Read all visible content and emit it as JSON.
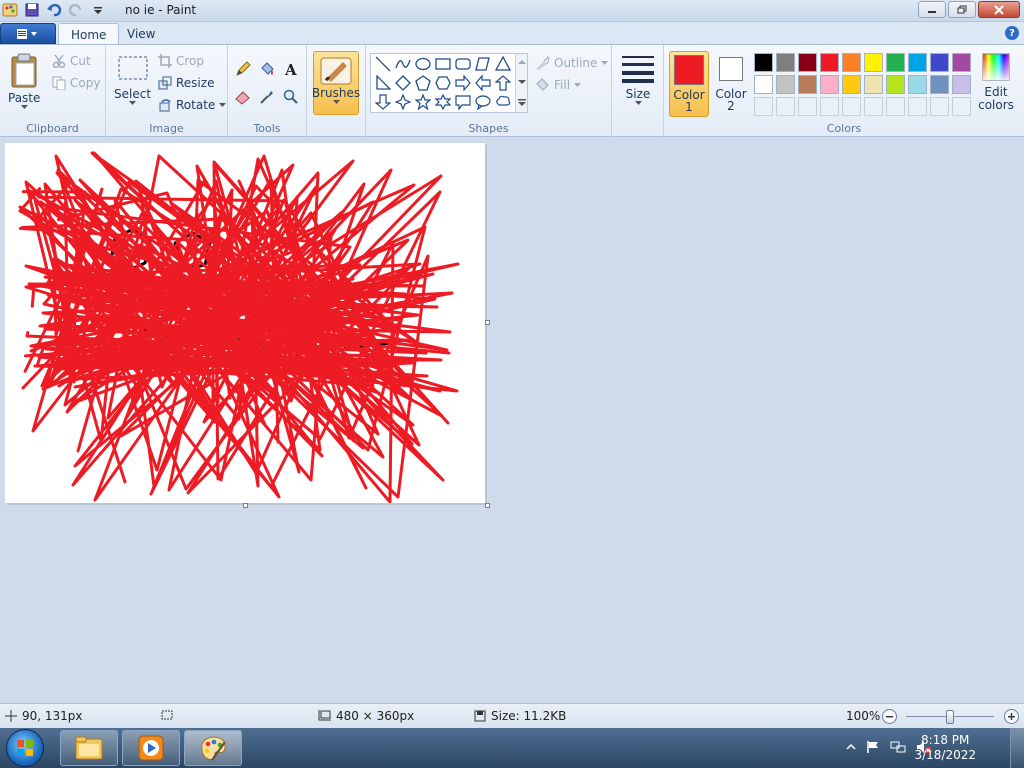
{
  "window": {
    "title": "no ie - Paint"
  },
  "tabs": [
    {
      "label": "Home"
    },
    {
      "label": "View"
    }
  ],
  "clipboard": {
    "paste": "Paste",
    "cut": "Cut",
    "copy": "Copy",
    "group": "Clipboard"
  },
  "image": {
    "select": "Select",
    "crop": "Crop",
    "resize": "Resize",
    "rotate": "Rotate",
    "group": "Image"
  },
  "tools": {
    "group": "Tools"
  },
  "brushes": {
    "label": "Brushes"
  },
  "shapes": {
    "outline": "Outline",
    "fill": "Fill",
    "group": "Shapes"
  },
  "size": {
    "label": "Size"
  },
  "colors": {
    "color1_label": "Color",
    "color1_num": "1",
    "color2_label": "Color",
    "color2_num": "2",
    "edit_label": "Edit",
    "edit_label2": "colors",
    "group": "Colors",
    "color1": "#ed1c24",
    "color2": "#ffffff",
    "row1": [
      "#000000",
      "#7f7f7f",
      "#880015",
      "#ed1c24",
      "#ff7f27",
      "#fff200",
      "#22b14c",
      "#00a2e8",
      "#3f48cc",
      "#a349a4"
    ],
    "row2": [
      "#ffffff",
      "#c3c3c3",
      "#b97a57",
      "#ffaec9",
      "#ffc90e",
      "#efe4b0",
      "#b5e61d",
      "#99d9ea",
      "#7092be",
      "#c8bfe7"
    ]
  },
  "drawing": {
    "stroke_color": "#ed1c24",
    "ink_color": "#000000"
  },
  "status": {
    "cursor_pos": "90, 131px",
    "canvas_dims": "480 × 360px",
    "file_size": "Size: 11.2KB",
    "zoom": "100%"
  },
  "taskbar": {
    "time": "8:18 PM",
    "date": "3/18/2022"
  }
}
